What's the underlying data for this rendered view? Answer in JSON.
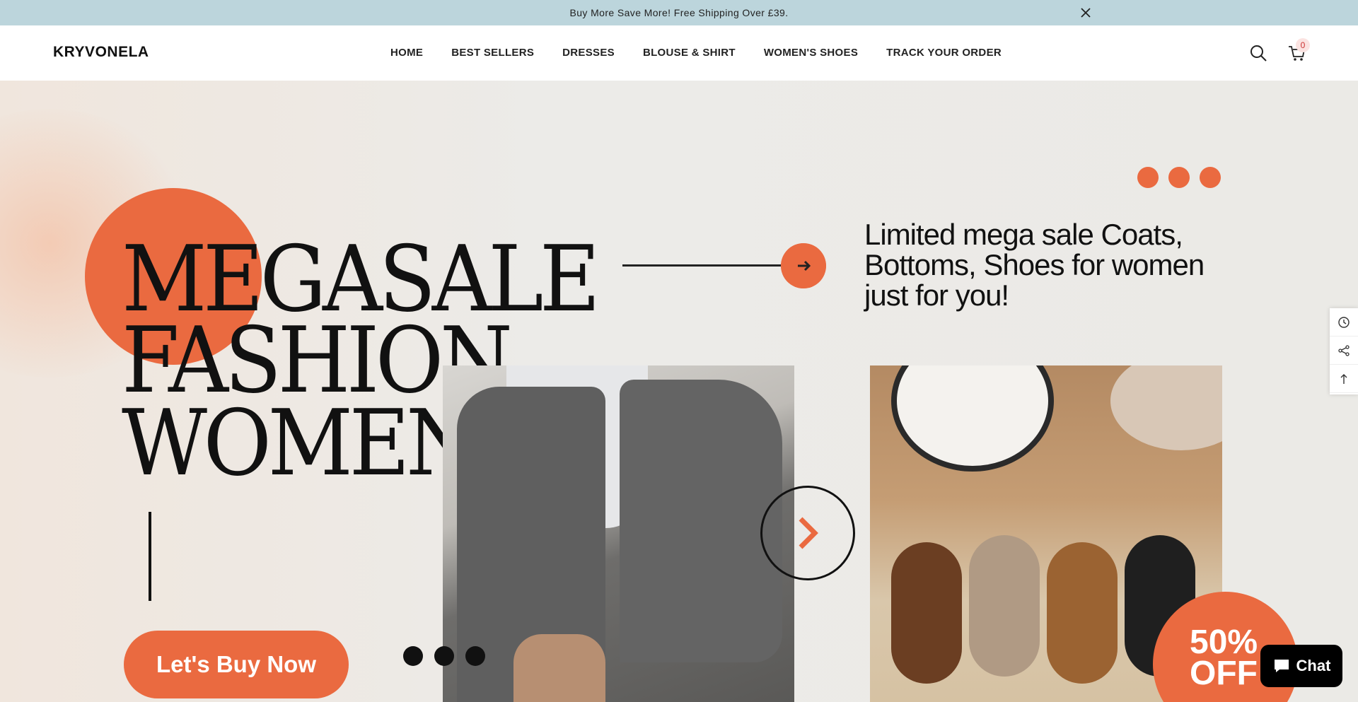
{
  "announcement": {
    "text": "Buy More Save More! Free Shipping Over £39.",
    "close_icon": "close-icon"
  },
  "header": {
    "logo": "KRYVONELA",
    "nav": [
      "HOME",
      "BEST SELLERS",
      "DRESSES",
      "BLOUSE & SHIRT",
      "WOMEN'S SHOES",
      "TRACK YOUR ORDER"
    ],
    "search_icon": "search-icon",
    "cart_icon": "cart-icon",
    "cart_count": "0"
  },
  "hero": {
    "headline": [
      "MEGASALE",
      "FASHION",
      "WOMEN"
    ],
    "tagline": "Limited mega sale Coats, Bottoms, Shoes  for women just for you!",
    "cta": "Let's Buy Now",
    "badge": [
      "50%",
      "OFF"
    ],
    "accent_color": "#ea6a40",
    "next_icon": "chevron-right-icon"
  },
  "side_tools": [
    "history-icon",
    "share-icon",
    "arrow-up-icon"
  ],
  "chat": {
    "label": "Chat",
    "icon": "chat-bubble-icon"
  }
}
